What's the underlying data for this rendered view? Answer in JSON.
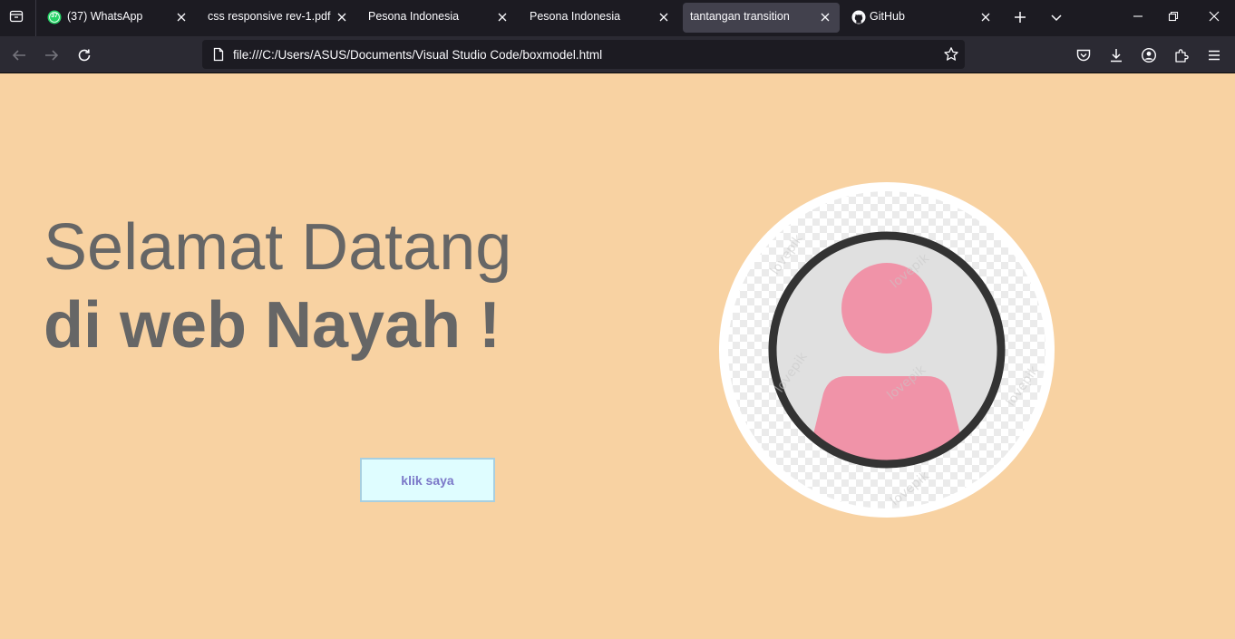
{
  "browser": {
    "tabs": [
      {
        "label": "(37) WhatsApp",
        "badge": "37",
        "icon": "whatsapp-icon",
        "active": false
      },
      {
        "label": "css responsive rev-1.pdf",
        "icon": "pdf-icon",
        "active": false
      },
      {
        "label": "Pesona Indonesia",
        "icon": "page-icon",
        "active": false
      },
      {
        "label": "Pesona Indonesia",
        "icon": "page-icon",
        "active": false
      },
      {
        "label": "tantangan transition",
        "icon": "page-icon",
        "active": true
      },
      {
        "label": "GitHub",
        "icon": "github-icon",
        "active": false
      }
    ],
    "url": "file:///C:/Users/ASUS/Documents/Visual Studio Code/boxmodel.html",
    "colors": {
      "tabstrip": "#1c1b22",
      "navbar": "#2b2a33",
      "active_tab": "#42414d"
    }
  },
  "page": {
    "background": "#f8d2a2",
    "heading_line1": "Selamat Datang",
    "heading_line2": "di web Nayah !",
    "button_label": "klik saya",
    "avatar_watermark": "lovepik",
    "colors": {
      "heading": "#666666",
      "button_bg": "#dffdff",
      "button_text": "#7b78c8",
      "avatar_pink": "#f093a8"
    }
  }
}
